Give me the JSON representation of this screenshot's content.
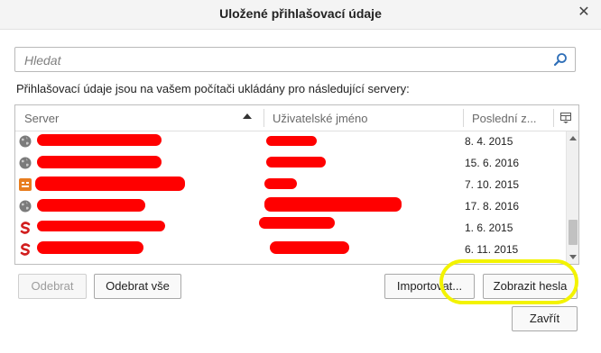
{
  "window": {
    "title": "Uložené přihlašovací údaje",
    "close_glyph": "✕"
  },
  "search": {
    "placeholder": "Hledat",
    "icon": "search-icon"
  },
  "description": "Přihlašovací údaje jsou na vašem počítači ukládány pro následující servery:",
  "table": {
    "columns": [
      "Server",
      "Uživatelské jméno",
      "Poslední z..."
    ],
    "sort_column": "Server",
    "sort_direction": "ascending",
    "rows": [
      {
        "icon": "globe-icon",
        "date": "8. 4. 2015"
      },
      {
        "icon": "globe-icon",
        "date": "15. 6. 2016"
      },
      {
        "icon": "site-favicon-orange",
        "date": "7. 10. 2015"
      },
      {
        "icon": "globe-icon",
        "date": "17. 8. 2016"
      },
      {
        "icon": "s-logo-icon",
        "date": "1. 6. 2015"
      },
      {
        "icon": "s-logo-icon",
        "date": "6. 11. 2015"
      }
    ]
  },
  "buttons": {
    "remove": "Odebrat",
    "remove_all": "Odebrat vše",
    "import": "Importovat...",
    "show_passwords": "Zobrazit hesla",
    "close": "Zavřít"
  },
  "colors": {
    "redaction": "#ff0000",
    "highlight": "#f3f300",
    "search_icon": "#2f6fb8"
  }
}
